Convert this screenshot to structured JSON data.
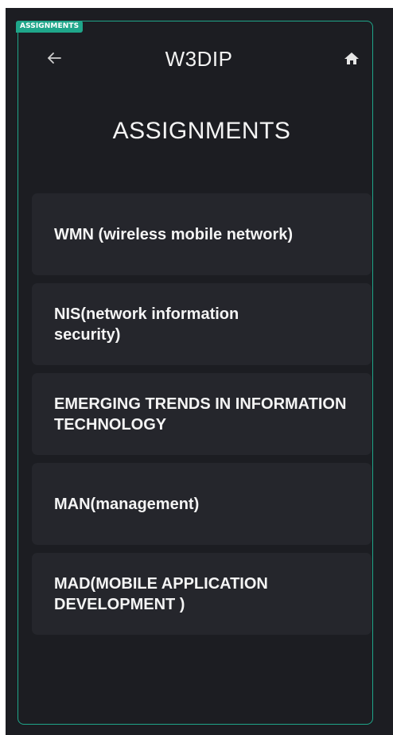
{
  "window": {
    "tag": "ASSIGNMENTS"
  },
  "header": {
    "back_icon": "arrow-left-icon",
    "title": "W3DIP",
    "home_icon": "home-icon"
  },
  "main": {
    "heading": "ASSIGNMENTS",
    "subjects": [
      {
        "label": "WMN (wireless mobile network)"
      },
      {
        "label": "NIS(network information security)"
      },
      {
        "label": "EMERGING TRENDS IN INFORMATION  TECHNOLOGY"
      },
      {
        "label": "MAN(management)"
      },
      {
        "label": "MAD(MOBILE APPLICATION DEVELOPMENT )"
      }
    ]
  },
  "colors": {
    "background": "#1c1d22",
    "card": "#25262c",
    "accent": "#1fa68a",
    "text": "#f4f4f4"
  }
}
